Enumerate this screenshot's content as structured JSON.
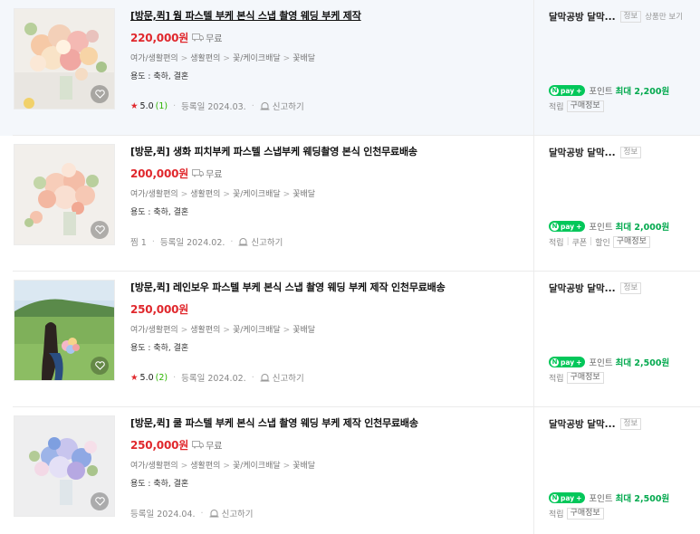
{
  "products": [
    {
      "title": "[방문,퀵] 웜 파스텔 부케 본식 스냅 촬영 웨딩 부케 제작",
      "price": "220,000원",
      "shipping": "무료",
      "category": [
        "여가/생활편의",
        "생활편의",
        "꽃/케이크배달",
        "꽃배달"
      ],
      "usage": "용도 : 축하, 결혼",
      "rating": "5.0",
      "reviews": "(1)",
      "zzim": "",
      "registered": "등록일 2024.03.",
      "report": "신고하기",
      "mall": "달막공방 달막...",
      "mall_badge": "정보",
      "mall_more": "상품만 보기",
      "npay_label": "pay",
      "point_label": "포인트",
      "point_value": "최대 2,200원",
      "tags": [
        "구매정보"
      ],
      "tag_prefix": "적립"
    },
    {
      "title": "[방문,퀵] 생화 피치부케 파스텔 스냅부케 웨딩촬영 본식 인천무료배송",
      "price": "200,000원",
      "shipping": "무료",
      "category": [
        "여가/생활편의",
        "생활편의",
        "꽃/케이크배달",
        "꽃배달"
      ],
      "usage": "용도 : 축하, 결혼",
      "rating": "",
      "reviews": "",
      "zzim": "찜 1",
      "registered": "등록일 2024.02.",
      "report": "신고하기",
      "mall": "달막공방 달막...",
      "mall_badge": "정보",
      "mall_more": "",
      "npay_label": "pay",
      "point_label": "포인트",
      "point_value": "최대 2,000원",
      "tags": [
        "구매정보"
      ],
      "tag_prefix": "적립",
      "tag_extra": [
        "쿠폰",
        "할인"
      ]
    },
    {
      "title": "[방문,퀵] 레인보우 파스텔 부케 본식 스냅 촬영 웨딩 부케 제작 인천무료배송",
      "price": "250,000원",
      "shipping": "",
      "category": [
        "여가/생활편의",
        "생활편의",
        "꽃/케이크배달",
        "꽃배달"
      ],
      "usage": "용도 : 축하, 결혼",
      "rating": "5.0",
      "reviews": "(2)",
      "zzim": "",
      "registered": "등록일 2024.02.",
      "report": "신고하기",
      "mall": "달막공방 달막...",
      "mall_badge": "정보",
      "mall_more": "",
      "npay_label": "pay",
      "point_label": "포인트",
      "point_value": "최대 2,500원",
      "tags": [
        "구매정보"
      ],
      "tag_prefix": "적립"
    },
    {
      "title": "[방문,퀵] 쿨 파스텔 부케 본식 스냅 촬영 웨딩 부케 제작 인천무료배송",
      "price": "250,000원",
      "shipping": "무료",
      "category": [
        "여가/생활편의",
        "생활편의",
        "꽃/케이크배달",
        "꽃배달"
      ],
      "usage": "용도 : 축하, 결혼",
      "rating": "",
      "reviews": "",
      "zzim": "",
      "registered": "등록일 2024.04.",
      "report": "신고하기",
      "mall": "달막공방 달막...",
      "mall_badge": "정보",
      "mall_more": "",
      "npay_label": "pay",
      "point_label": "포인트",
      "point_value": "최대 2,500원",
      "tags": [
        "구매정보"
      ],
      "tag_prefix": "적립"
    }
  ],
  "icons": {
    "heart": "heart-icon",
    "truck": "truck-icon",
    "bell": "report-bell-icon",
    "star": "star-icon"
  },
  "colors": {
    "price": "#e0282d",
    "npay": "#03c75a",
    "point": "#03a94e",
    "highlight_bg": "#f4f7fb"
  }
}
